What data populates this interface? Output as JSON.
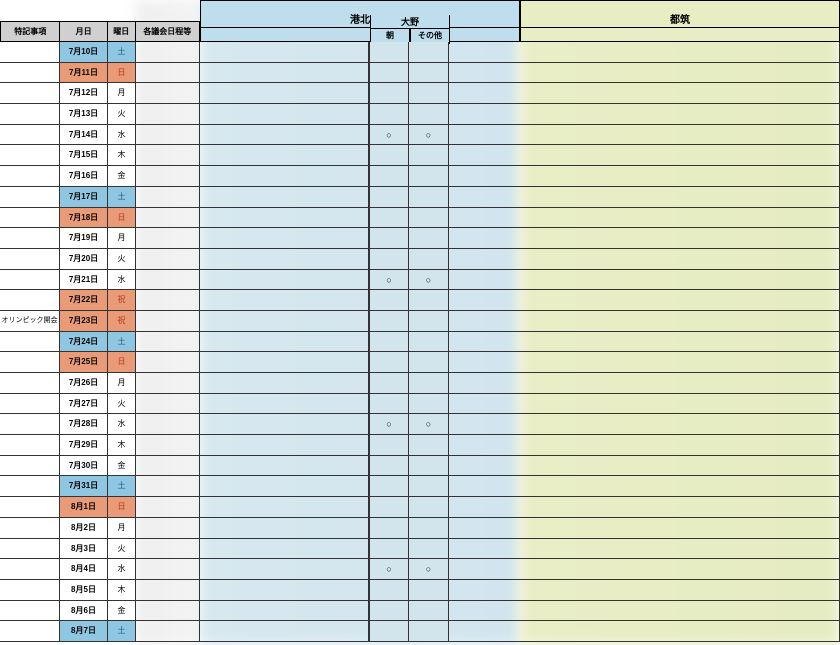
{
  "headers": {
    "note": "特記事項",
    "date": "月日",
    "dow": "曜日",
    "schedule": "各議会日程等"
  },
  "regions": {
    "kohoku": {
      "title": "港北",
      "sub": "大野",
      "cols": [
        "朝",
        "その他"
      ]
    },
    "tsuzuki": {
      "title": "都筑"
    }
  },
  "rows": [
    {
      "note": "",
      "date": "7月10日",
      "dow": "土",
      "type": "sat",
      "m1": "",
      "m2": ""
    },
    {
      "note": "",
      "date": "7月11日",
      "dow": "日",
      "type": "sun",
      "m1": "",
      "m2": ""
    },
    {
      "note": "",
      "date": "7月12日",
      "dow": "月",
      "type": "normal",
      "m1": "",
      "m2": ""
    },
    {
      "note": "",
      "date": "7月13日",
      "dow": "火",
      "type": "normal",
      "m1": "",
      "m2": ""
    },
    {
      "note": "",
      "date": "7月14日",
      "dow": "水",
      "type": "normal",
      "m1": "○",
      "m2": "○"
    },
    {
      "note": "",
      "date": "7月15日",
      "dow": "木",
      "type": "normal",
      "m1": "",
      "m2": ""
    },
    {
      "note": "",
      "date": "7月16日",
      "dow": "金",
      "type": "normal",
      "m1": "",
      "m2": ""
    },
    {
      "note": "",
      "date": "7月17日",
      "dow": "土",
      "type": "sat",
      "m1": "",
      "m2": ""
    },
    {
      "note": "",
      "date": "7月18日",
      "dow": "日",
      "type": "sun",
      "m1": "",
      "m2": ""
    },
    {
      "note": "",
      "date": "7月19日",
      "dow": "月",
      "type": "normal",
      "m1": "",
      "m2": ""
    },
    {
      "note": "",
      "date": "7月20日",
      "dow": "火",
      "type": "normal",
      "m1": "",
      "m2": ""
    },
    {
      "note": "",
      "date": "7月21日",
      "dow": "水",
      "type": "normal",
      "m1": "○",
      "m2": "○"
    },
    {
      "note": "",
      "date": "7月22日",
      "dow": "祝",
      "type": "hol",
      "m1": "",
      "m2": ""
    },
    {
      "note": "オリンピック開会",
      "date": "7月23日",
      "dow": "祝",
      "type": "hol",
      "m1": "",
      "m2": ""
    },
    {
      "note": "",
      "date": "7月24日",
      "dow": "土",
      "type": "sat",
      "m1": "",
      "m2": ""
    },
    {
      "note": "",
      "date": "7月25日",
      "dow": "日",
      "type": "sun",
      "m1": "",
      "m2": ""
    },
    {
      "note": "",
      "date": "7月26日",
      "dow": "月",
      "type": "normal",
      "m1": "",
      "m2": ""
    },
    {
      "note": "",
      "date": "7月27日",
      "dow": "火",
      "type": "normal",
      "m1": "",
      "m2": ""
    },
    {
      "note": "",
      "date": "7月28日",
      "dow": "水",
      "type": "normal",
      "m1": "○",
      "m2": "○"
    },
    {
      "note": "",
      "date": "7月29日",
      "dow": "木",
      "type": "normal",
      "m1": "",
      "m2": ""
    },
    {
      "note": "",
      "date": "7月30日",
      "dow": "金",
      "type": "normal",
      "m1": "",
      "m2": ""
    },
    {
      "note": "",
      "date": "7月31日",
      "dow": "土",
      "type": "sat",
      "m1": "",
      "m2": ""
    },
    {
      "note": "",
      "date": "8月1日",
      "dow": "日",
      "type": "sun",
      "m1": "",
      "m2": ""
    },
    {
      "note": "",
      "date": "8月2日",
      "dow": "月",
      "type": "normal",
      "m1": "",
      "m2": ""
    },
    {
      "note": "",
      "date": "8月3日",
      "dow": "火",
      "type": "normal",
      "m1": "",
      "m2": ""
    },
    {
      "note": "",
      "date": "8月4日",
      "dow": "水",
      "type": "normal",
      "m1": "○",
      "m2": "○"
    },
    {
      "note": "",
      "date": "8月5日",
      "dow": "木",
      "type": "normal",
      "m1": "",
      "m2": ""
    },
    {
      "note": "",
      "date": "8月6日",
      "dow": "金",
      "type": "normal",
      "m1": "",
      "m2": ""
    },
    {
      "note": "",
      "date": "8月7日",
      "dow": "土",
      "type": "sat",
      "m1": "",
      "m2": ""
    }
  ]
}
